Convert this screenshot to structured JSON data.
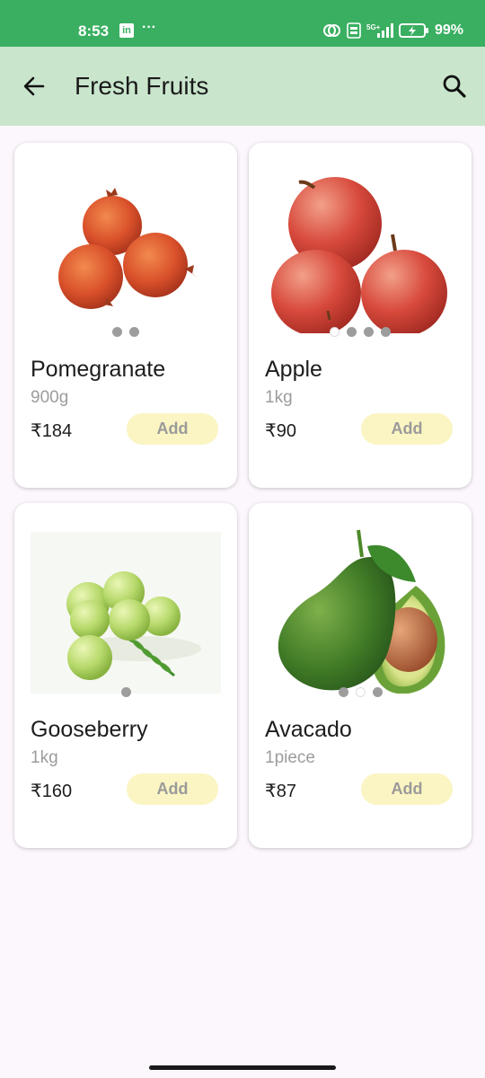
{
  "status_bar": {
    "time": "8:53",
    "linkedin_icon_text": "in",
    "more": "···",
    "battery_percent": "99%"
  },
  "app_bar": {
    "title": "Fresh Fruits",
    "back_icon": "arrow-back-icon",
    "search_icon": "search-icon",
    "background": "#c9e6cc"
  },
  "products": [
    {
      "name": "Pomegranate",
      "quantity": "900g",
      "price": "₹184",
      "add_label": "Add",
      "image_icon": "pomegranate-image",
      "dots": 2
    },
    {
      "name": "Apple",
      "quantity": "1kg",
      "price": "₹90",
      "add_label": "Add",
      "image_icon": "apple-image",
      "dots": 4
    },
    {
      "name": "Gooseberry",
      "quantity": "1kg",
      "price": "₹160",
      "add_label": "Add",
      "image_icon": "gooseberry-image",
      "dots": 1
    },
    {
      "name": "Avacado",
      "quantity": "1piece",
      "price": "₹87",
      "add_label": "Add",
      "image_icon": "avocado-image",
      "dots": 3
    }
  ],
  "colors": {
    "status_bar": "#3aaf61",
    "page_background": "#fcf6fd",
    "add_button": "#fbf5c3"
  }
}
